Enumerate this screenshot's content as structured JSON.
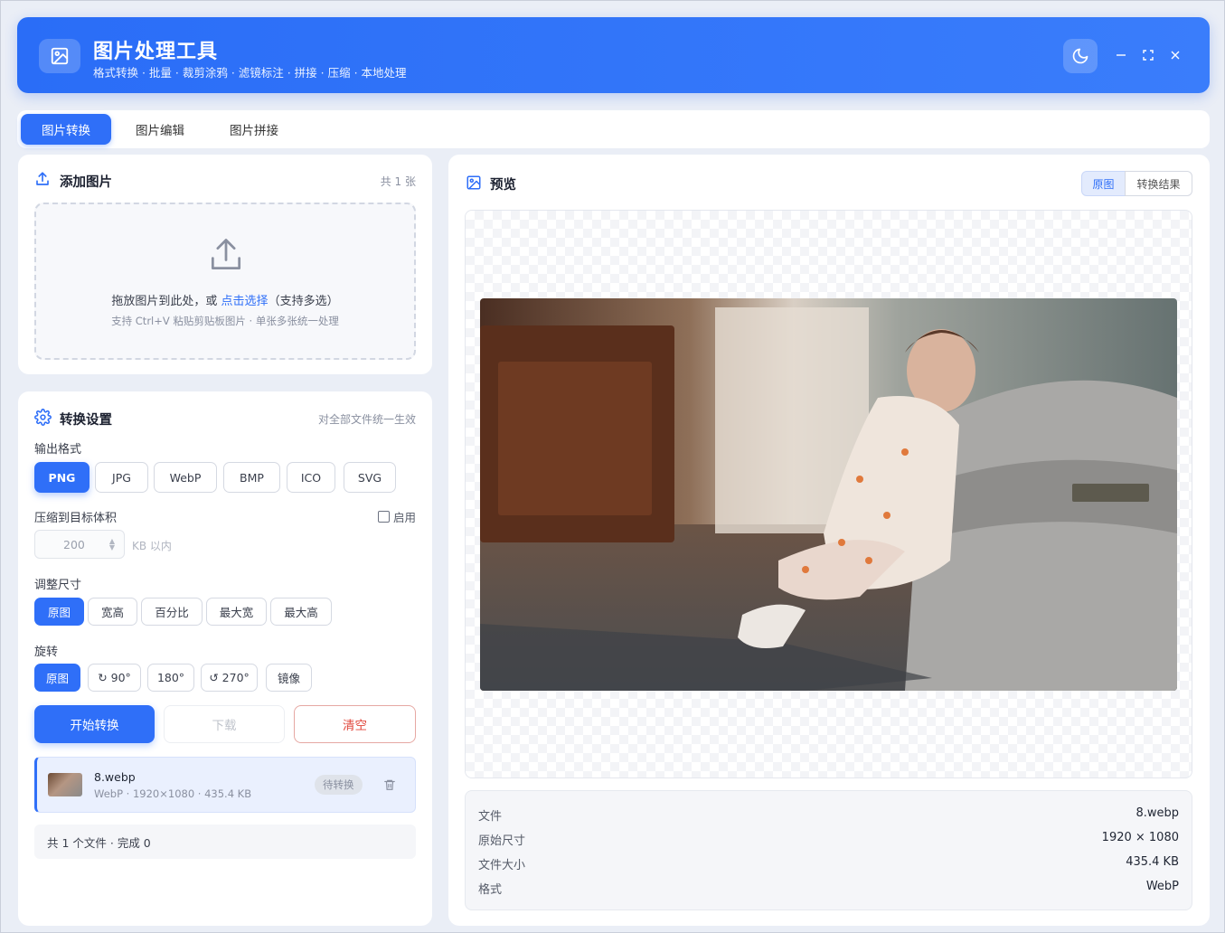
{
  "app": {
    "title": "图片处理工具",
    "subtitle": "格式转换 · 批量 · 裁剪涂鸦 · 滤镜标注 · 拼接 · 压缩 · 本地处理"
  },
  "tabs": [
    {
      "label": "图片转换"
    },
    {
      "label": "图片编辑"
    },
    {
      "label": "图片拼接"
    }
  ],
  "add_panel": {
    "title": "添加图片",
    "count": "共 1 张",
    "drop_text_before": "拖放图片到此处，或 ",
    "drop_link": "点击选择",
    "drop_text_after": "（支持多选）",
    "drop_hint": "支持 Ctrl+V 粘贴剪贴板图片 · 单张多张统一处理"
  },
  "settings": {
    "title": "转换设置",
    "scope_note": "对全部文件统一生效",
    "output_format_label": "输出格式",
    "formats": [
      "PNG",
      "JPG",
      "WebP",
      "BMP",
      "ICO",
      "SVG"
    ],
    "compress_label": "压缩到目标体积",
    "compress_enable_label": "启用",
    "compress_value": "200",
    "compress_unit": "KB 以内",
    "resize_label": "调整尺寸",
    "resize_options": [
      "原图",
      "宽高",
      "百分比",
      "最大宽",
      "最大高"
    ],
    "rotate_label": "旋转",
    "rotate_options": [
      "原图",
      "↻ 90°",
      "180°",
      "↺ 270°",
      "镜像"
    ],
    "start_label": "开始转换",
    "download_label": "下载",
    "clear_label": "清空",
    "active_color": "#2f6ff8",
    "clear_color": "#e0453a"
  },
  "file_list": [
    {
      "name": "8.webp",
      "meta": "WebP · 1920×1080 · 435.4 KB",
      "status": "待转换"
    }
  ],
  "summary": "共 1 个文件 · 完成 0",
  "preview": {
    "title": "预览",
    "toggle": [
      "原图",
      "转换结果"
    ],
    "info": [
      {
        "key": "文件",
        "value": "8.webp"
      },
      {
        "key": "原始尺寸",
        "value": "1920 × 1080"
      },
      {
        "key": "文件大小",
        "value": "435.4 KB"
      },
      {
        "key": "格式",
        "value": "WebP"
      }
    ]
  }
}
